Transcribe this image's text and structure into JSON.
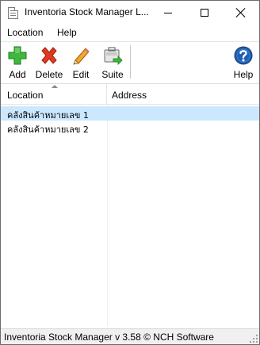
{
  "window": {
    "title": "Inventoria Stock Manager L..."
  },
  "menu": {
    "items": [
      "Location",
      "Help"
    ]
  },
  "toolbar": {
    "add_label": "Add",
    "delete_label": "Delete",
    "edit_label": "Edit",
    "suite_label": "Suite",
    "help_label": "Help"
  },
  "list": {
    "columns": [
      "Location",
      "Address"
    ],
    "sort_column": "Location",
    "rows": [
      {
        "location": "คลังสินค้าหมายเลข 1",
        "address": "",
        "selected": true
      },
      {
        "location": "คลังสินค้าหมายเลข 2",
        "address": "",
        "selected": false
      }
    ]
  },
  "status": {
    "text": "Inventoria Stock Manager v 3.58 © NCH Software"
  },
  "colors": {
    "selection": "#cce8ff",
    "add_icon": "#3db83d",
    "delete_icon": "#e03a1e",
    "help_icon": "#1e5fb4"
  },
  "icons": {
    "add": "plus-icon",
    "delete": "x-icon",
    "edit": "pencil-icon",
    "suite": "suite-icon",
    "help": "help-icon"
  }
}
